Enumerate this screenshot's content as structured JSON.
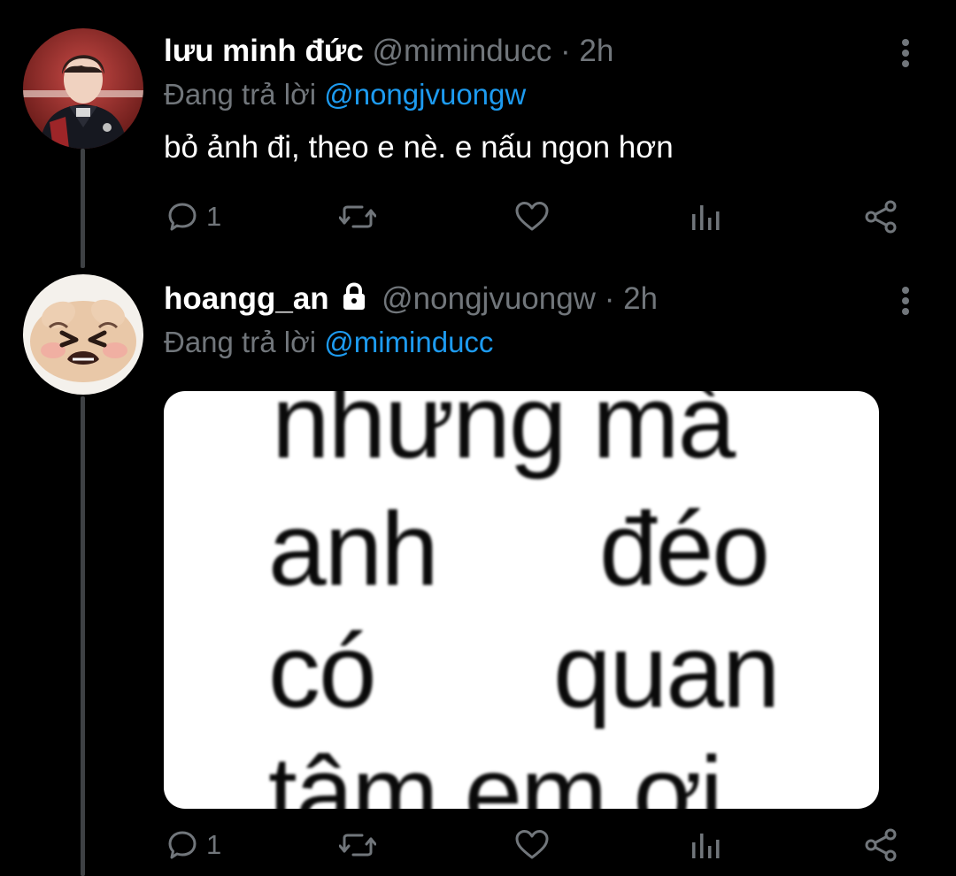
{
  "tweets": [
    {
      "display_name": "lưu minh đức",
      "handle": "@miminducc",
      "separator": "·",
      "time": "2h",
      "reply_prefix": "Đang trả lời",
      "reply_to": "@nongjvuongw",
      "text": "bỏ ảnh đi, theo e nè. e nấu ngon hơn",
      "reply_count": "1",
      "avatar_icon": "person-photo-icon"
    },
    {
      "display_name": "hoangg_an",
      "protected_icon": "lock-icon",
      "handle": "@nongjvuongw",
      "separator": "·",
      "time": "2h",
      "reply_prefix": "Đang trả lời",
      "reply_to": "@miminducc",
      "reply_count": "1",
      "avatar_icon": "crying-cartoon-icon",
      "media_text": {
        "line1": "nhưng mà",
        "line2_left": "anh",
        "line2_right": "đéo",
        "line3_left": "có",
        "line3_right": "quan",
        "line4": "tâm em ơi"
      }
    }
  ],
  "colors": {
    "background": "#000000",
    "muted": "#71767b",
    "link": "#1d9bf0",
    "thread_line": "#3e4144"
  }
}
